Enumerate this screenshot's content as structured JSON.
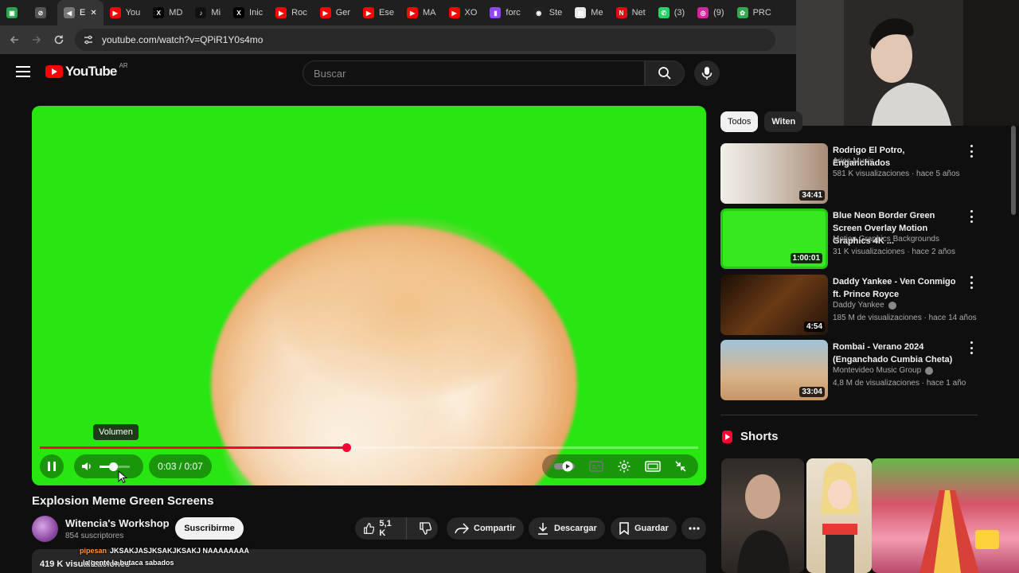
{
  "browser": {
    "tabs": [
      {
        "label": "",
        "color": "#2ea44f",
        "glyph": "▣"
      },
      {
        "label": "",
        "color": "#555555",
        "glyph": "⊘"
      },
      {
        "label": "E",
        "color": "#777777",
        "glyph": "◀"
      },
      {
        "label": "You",
        "color": "#ff0000",
        "glyph": "▶"
      },
      {
        "label": "MD",
        "color": "#000000",
        "glyph": "X"
      },
      {
        "label": "Mi",
        "color": "#111111",
        "glyph": "♪"
      },
      {
        "label": "Inic",
        "color": "#000000",
        "glyph": "X"
      },
      {
        "label": "Roc",
        "color": "#ff0000",
        "glyph": "▶"
      },
      {
        "label": "Ger",
        "color": "#ff0000",
        "glyph": "▶"
      },
      {
        "label": "Ese",
        "color": "#ff0000",
        "glyph": "▶"
      },
      {
        "label": "MA",
        "color": "#ff0000",
        "glyph": "▶"
      },
      {
        "label": "XO",
        "color": "#ff0000",
        "glyph": "▶"
      },
      {
        "label": "forc",
        "color": "#9146ff",
        "glyph": "▮"
      },
      {
        "label": "Ste",
        "color": "#222222",
        "glyph": "◉"
      },
      {
        "label": "Me",
        "color": "#e8e8e8",
        "glyph": "▦"
      },
      {
        "label": "Net",
        "color": "#e50914",
        "glyph": "N"
      },
      {
        "label": "(3)",
        "color": "#25d366",
        "glyph": "✆"
      },
      {
        "label": "(9)",
        "color": "#d6249f",
        "glyph": "◎"
      },
      {
        "label": "PRC",
        "color": "#34a853",
        "glyph": "✿"
      }
    ],
    "url": "youtube.com/watch?v=QPiR1Y0s4mo"
  },
  "header": {
    "logo_text": "YouTube",
    "country_code": "AR",
    "search_placeholder": "Buscar"
  },
  "player": {
    "current_time": "0:03",
    "duration": "0:07",
    "time_display": "0:03 / 0:07",
    "progress_fraction": 0.4655,
    "volume_fraction": 0.45,
    "tooltip": "Volumen",
    "background_color": "#28e612"
  },
  "video": {
    "title": "Explosion Meme Green Screens",
    "channel": "Witencia's Workshop",
    "subscribers": "854 suscriptores",
    "subscribe_label": "Suscribirme",
    "likes": "5,1 K",
    "share_label": "Compartir",
    "download_label": "Descargar",
    "save_label": "Guardar",
    "views": "419 K visualizaciones"
  },
  "chat_overlay": [
    {
      "user": "pipesan",
      "message": "JKSAKJASJKSAKJKSAKJ NAAAAAAAA"
    },
    {
      "user": "",
      "message": "la gente la butaca sabados"
    }
  ],
  "sidebar": {
    "chips": [
      "Todos",
      "Witen"
    ],
    "recommendations": [
      {
        "title": "Rodrigo El Potro, Enganchados",
        "channel": "Aries Music",
        "verified": false,
        "meta": "581 K visualizaciones · hace 5 años",
        "duration": "34:41"
      },
      {
        "title": "Blue Neon Border Green Screen Overlay Motion Graphics 4K ...",
        "channel": "Motion Graphics Backgrounds",
        "verified": false,
        "meta": "31 K visualizaciones · hace 2 años",
        "duration": "1:00:01"
      },
      {
        "title": "Daddy Yankee - Ven Conmigo ft. Prince Royce",
        "channel": "Daddy Yankee",
        "verified": true,
        "meta": "185 M de visualizaciones · hace 14 años",
        "duration": "4:54"
      },
      {
        "title": "Rombai - Verano 2024 (Enganchado Cumbia Cheta)",
        "channel": "Montevideo Music Group",
        "verified": true,
        "meta": "4,8 M de visualizaciones · hace 1 año",
        "duration": "33:04"
      }
    ],
    "shorts_label": "Shorts"
  }
}
